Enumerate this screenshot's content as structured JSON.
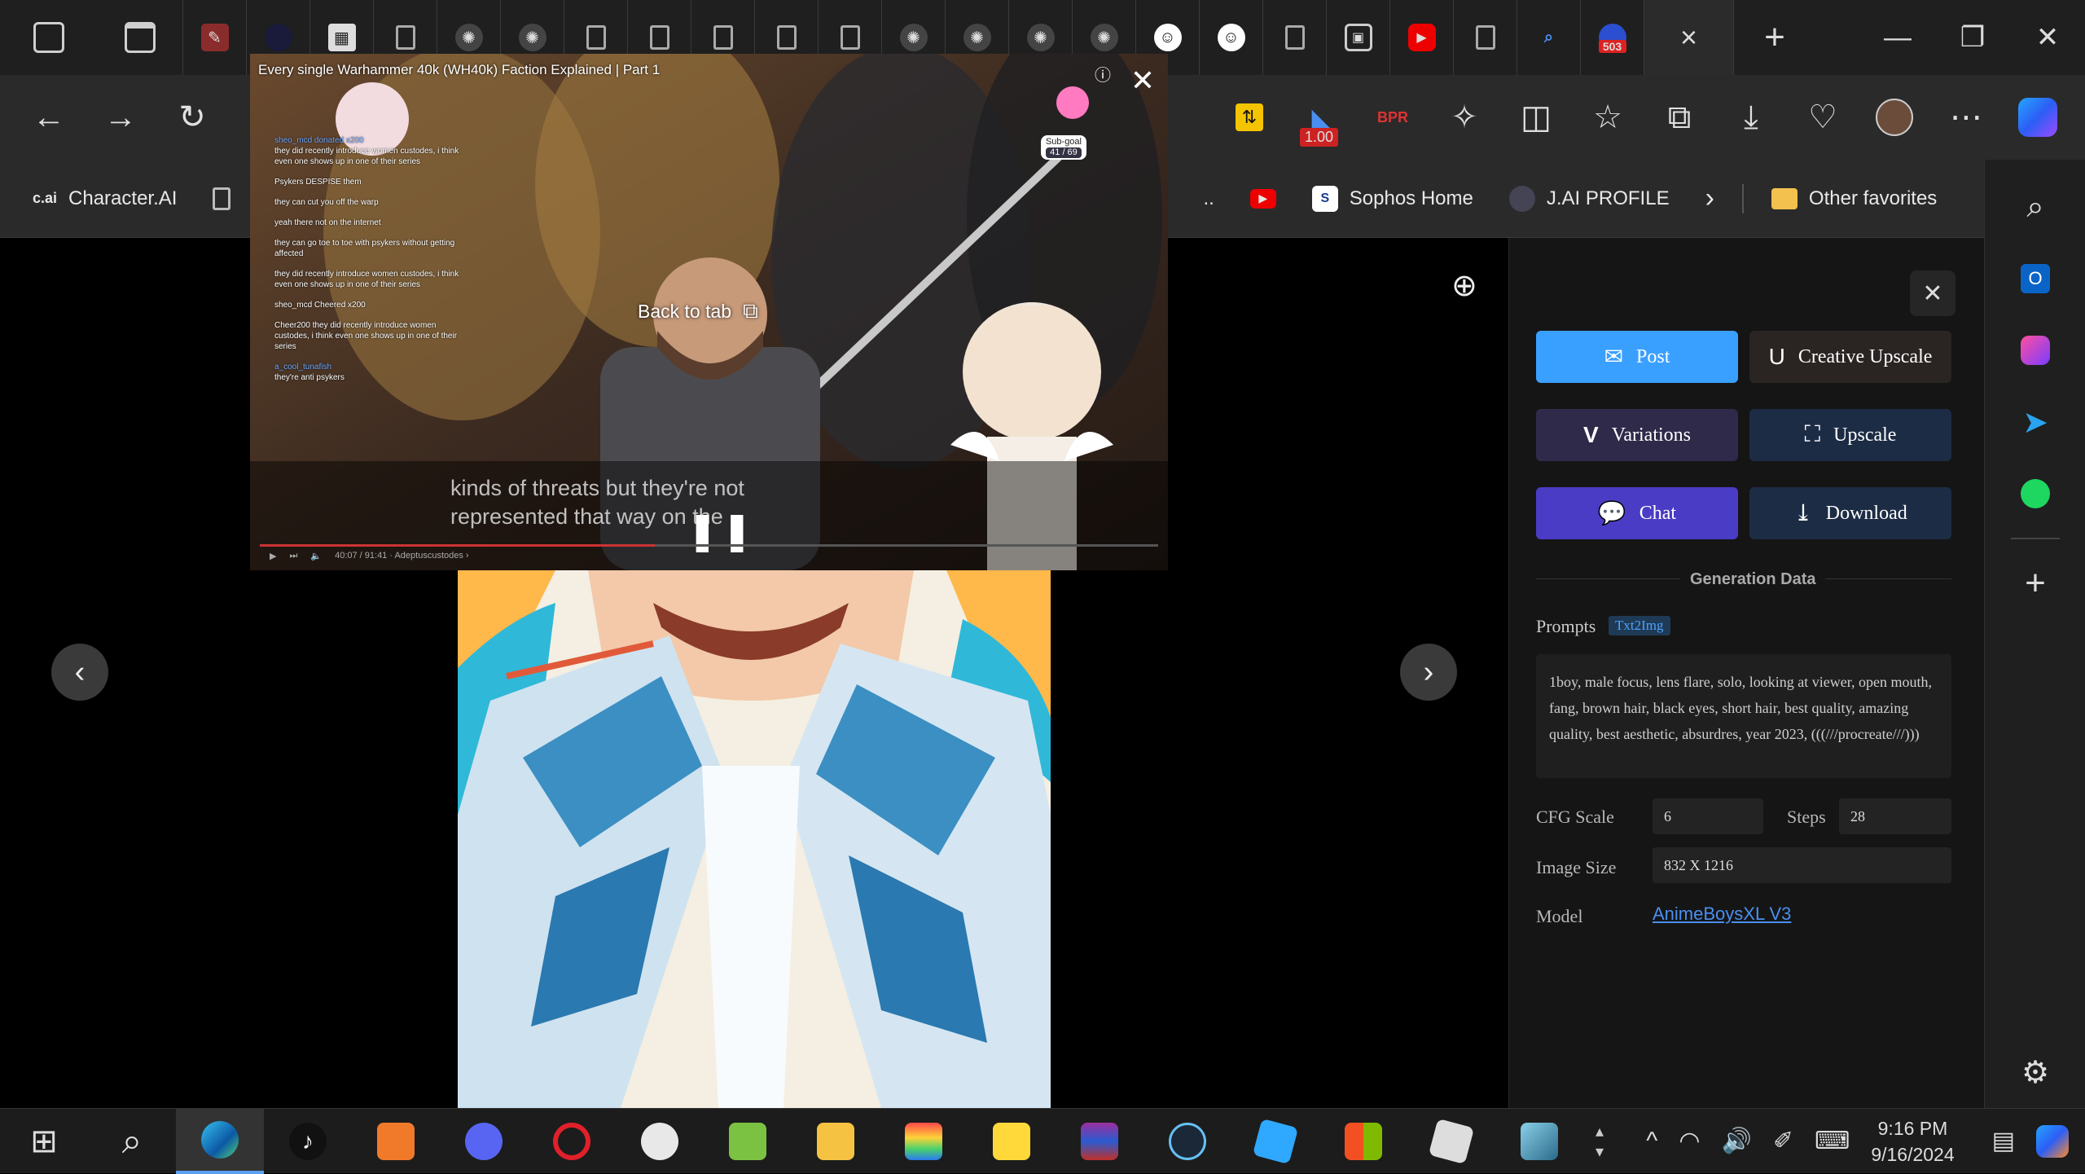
{
  "browser": {
    "tab_tooltip_badge": "503",
    "active_tab_close": "×",
    "new_tab": "+",
    "window": {
      "minimize": "—",
      "restore": "❐",
      "close": "✕"
    },
    "toolbar_badge": "1.00",
    "ext_label": "BPR"
  },
  "favorites": {
    "items": [
      {
        "icon_text": "c.ai",
        "label": "Character.AI"
      },
      {
        "icon_text": "",
        "label": ""
      },
      {
        "icon_text": "S",
        "label": "Sophos Home"
      },
      {
        "icon_text": "",
        "label": "J.AI PROFILE"
      }
    ],
    "ellipsis": "..",
    "overflow": "›",
    "other": "Other favorites"
  },
  "pip": {
    "title": "Every single Warhammer 40k (WH40k) Faction Explained | Part 1",
    "back_to_tab": "Back to tab",
    "subtitle_line1": "kinds of threats but they're not",
    "subtitle_line2": "represented that way on the",
    "subgoal_label": "Sub-goal",
    "subgoal_value": "41 / 69",
    "progress": 0.44,
    "time": "40:07 / 91:41 · Adeptuscustodes ›",
    "chat": [
      {
        "user": "sheo_mcd donated x200",
        "text": "they did recently introduce women custodes, i think even one shows up in one of their series"
      },
      {
        "user": "",
        "text": "Psykers DESPISE them"
      },
      {
        "user": "",
        "text": "they can cut you off the warp"
      },
      {
        "user": "",
        "text": "yeah there not on the internet"
      },
      {
        "user": "",
        "text": "they can go toe to toe with psykers without getting affected"
      },
      {
        "user": "",
        "text": "they did recently introduce women custodes, i think even one shows up in one of their series"
      },
      {
        "user": "",
        "text": "sheo_mcd Cheered x200"
      },
      {
        "user": "",
        "text": "Cheer200 they did recently introduce women custodes, i think even one shows up in one of their series"
      },
      {
        "user": "a_cool_tunafish",
        "text": "they're anti psykers"
      }
    ]
  },
  "panel": {
    "buttons": {
      "post": "Post",
      "creative_upscale": "Creative Upscale",
      "variations": "Variations",
      "upscale": "Upscale",
      "chat": "Chat",
      "download": "Download"
    },
    "generation_data_title": "Generation Data",
    "prompts_label": "Prompts",
    "prompts_tag": "Txt2Img",
    "prompt_text": "1boy, male focus, lens flare, solo, looking at viewer, open mouth, fang, brown hair, black eyes, short hair, best quality, amazing quality, best aesthetic, absurdres, year 2023, (((///procreate///)))",
    "cfg_label": "CFG Scale",
    "cfg_value": "6",
    "steps_label": "Steps",
    "steps_value": "28",
    "size_label": "Image Size",
    "size_value": "832 X 1216",
    "model_label": "Model",
    "model_value": "AnimeBoysXL V3"
  },
  "taskbar": {
    "time": "9:16 PM",
    "date": "9/16/2024",
    "up_arrow": "^"
  },
  "colors": {
    "post_btn": "#3aa0ff",
    "chat_btn": "#4a3cc4",
    "variations_btn": "#2f2a4a",
    "upscale_btn": "#1d2c45",
    "creative_btn": "#2a2523",
    "model_link": "#4a8ff0"
  }
}
